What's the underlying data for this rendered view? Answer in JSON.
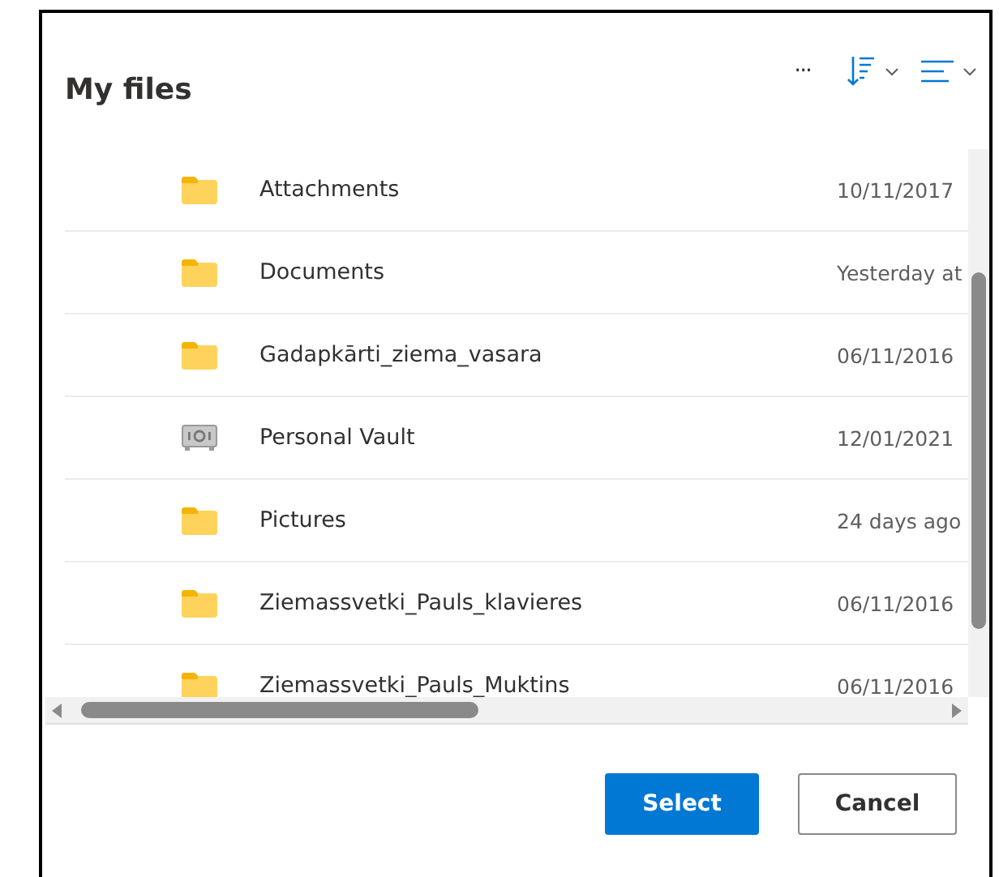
{
  "dialog": {
    "title": "My files"
  },
  "toolbar": {
    "more": "···"
  },
  "files": [
    {
      "kind": "folder",
      "name": "Attachments",
      "modified": "10/11/2017"
    },
    {
      "kind": "folder",
      "name": "Documents",
      "modified": "Yesterday at"
    },
    {
      "kind": "folder",
      "name": "Gadapkārti_ziema_vasara",
      "modified": "06/11/2016"
    },
    {
      "kind": "vault",
      "name": "Personal Vault",
      "modified": "12/01/2021"
    },
    {
      "kind": "folder",
      "name": "Pictures",
      "modified": "24 days ago"
    },
    {
      "kind": "folder",
      "name": "Ziemassvetki_Pauls_klavieres",
      "modified": "06/11/2016"
    },
    {
      "kind": "folder",
      "name": "Ziemassvetki_Pauls_Muktins",
      "modified": "06/11/2016"
    }
  ],
  "buttons": [
    {
      "kind": "primary",
      "label": "Select"
    },
    {
      "kind": "secondary",
      "label": "Cancel"
    }
  ]
}
